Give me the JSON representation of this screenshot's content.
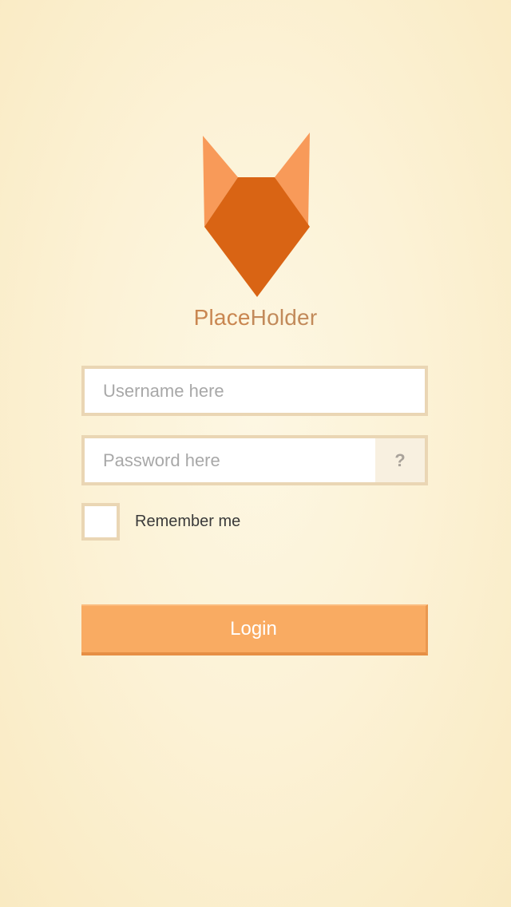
{
  "brand": {
    "name_part1": "Place",
    "name_part2": "Holder",
    "logo_icon": "fox-head-icon",
    "colors": {
      "ear": "#f89a59",
      "face": "#d96414",
      "text": "#c98650"
    }
  },
  "login_form": {
    "username": {
      "placeholder": "Username here",
      "value": ""
    },
    "password": {
      "placeholder": "Password here",
      "value": "",
      "help_label": "?"
    },
    "remember": {
      "label": "Remember me",
      "checked": false
    },
    "submit_label": "Login",
    "accent_color": "#f9ab62"
  }
}
